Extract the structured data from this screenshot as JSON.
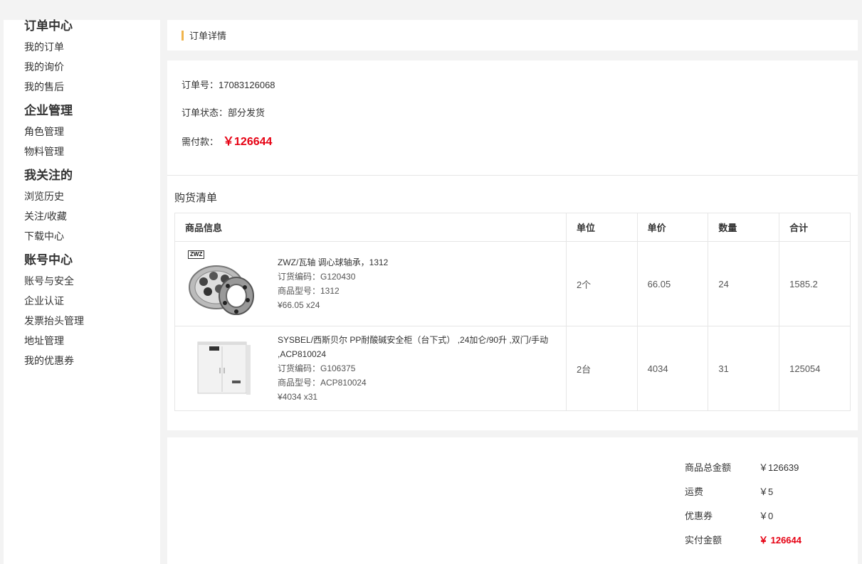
{
  "sidebar": {
    "groups": [
      {
        "title": "订单中心",
        "items": [
          "我的订单",
          "我的询价",
          "我的售后"
        ]
      },
      {
        "title": "企业管理",
        "items": [
          "角色管理",
          "物料管理"
        ]
      },
      {
        "title": "我关注的",
        "items": [
          "浏览历史",
          "关注/收藏",
          "下载中心"
        ]
      },
      {
        "title": "账号中心",
        "items": [
          "账号与安全",
          "企业认证",
          "发票抬头管理",
          "地址管理",
          "我的优惠券"
        ]
      }
    ]
  },
  "header": {
    "title": "订单详情"
  },
  "order": {
    "number_label": "订单号：17083126068",
    "status_label": "订单状态：部分发货",
    "pay_label": "需付款：",
    "pay_amount": "￥126644"
  },
  "list": {
    "title": "购货清单",
    "columns": [
      "商品信息",
      "单位",
      "单价",
      "数量",
      "合计"
    ],
    "rows": [
      {
        "name": "ZWZ/瓦轴 调心球轴承，1312",
        "code": "订货编码：G120430",
        "model": "商品型号：1312",
        "price_qty": "¥66.05 x24",
        "unit": "2个",
        "unit_price": "66.05",
        "qty": "24",
        "total": "1585.2",
        "icon": "bearing-image",
        "badge": "ZWZ"
      },
      {
        "name": "SYSBEL/西斯贝尔 PP耐酸碱安全柜（台下式） ,24加仑/90升 ,双门/手动 ,ACP810024",
        "code": "订货编码：G106375",
        "model": "商品型号：ACP810024",
        "price_qty": "¥4034 x31",
        "unit": "2台",
        "unit_price": "4034",
        "qty": "31",
        "total": "125054",
        "icon": "cabinet-image"
      }
    ]
  },
  "summary": {
    "goods_label": "商品总金额",
    "goods_value": "￥126639",
    "shipping_label": "运费",
    "shipping_value": "￥5",
    "coupon_label": "优惠券",
    "coupon_value": "￥0",
    "paid_label": "实付金额",
    "paid_value": "￥ 126644"
  },
  "colors": {
    "accent": "#f0b44c",
    "price_red": "#e60012"
  }
}
